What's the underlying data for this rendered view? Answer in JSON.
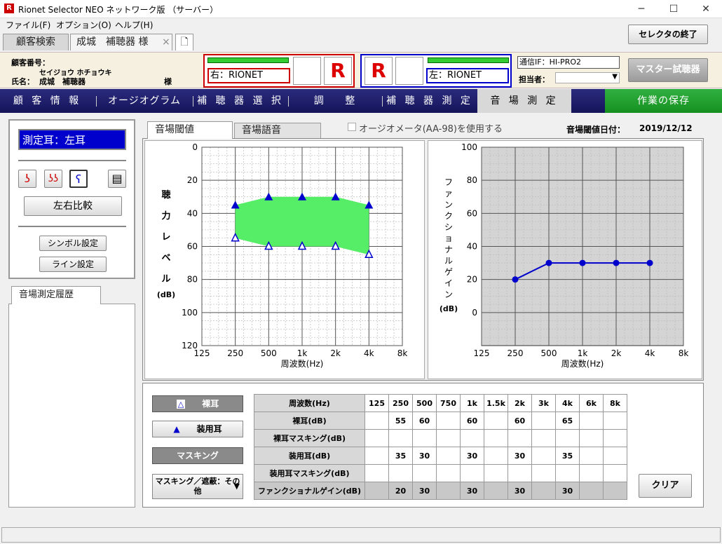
{
  "window": {
    "title": "Rionet Selector NEO ネットワーク版 （サーバー）",
    "icon": "R"
  },
  "menu": [
    "ファイル(F)",
    "オプション(O)",
    "ヘルプ(H)"
  ],
  "tabs": {
    "search": "顧客検索",
    "customer": "成城　補聴器 様",
    "close": "×"
  },
  "exit_button": "セレクタの終了",
  "info": {
    "customer_no_label": "顧客番号：",
    "kana": "セイジョウ ホチョウキ",
    "name_label": "氏名：",
    "name": "成城　補聴器",
    "sama": "様",
    "right_label": "右：RIONET",
    "left_label": "左：RIONET",
    "comm_label": "通信IF：HI-PRO2",
    "staff_label": "担当者：",
    "staff_value": "",
    "master_button": "マスター試聴器"
  },
  "nav": [
    "顧 客 情 報",
    "オージオグラム",
    "補 聴 器 選 択",
    "調　 整",
    "補 聴 器 測 定",
    "音 場 測 定",
    "作業の保存"
  ],
  "left": {
    "ear": "測定耳：左耳",
    "compare": "左右比較",
    "symbol": "シンボル設定",
    "line": "ライン設定",
    "history_tab": "音場測定履歴"
  },
  "subtabs": {
    "threshold": "音場閾値",
    "speech": "音場語音"
  },
  "audiometer_check": "オージオメータ(AA-98)を使用する",
  "date": {
    "label": "音場閾値日付：",
    "value": "2019/12/12"
  },
  "chart_data": [
    {
      "type": "line",
      "x": [
        "125",
        "250",
        "500",
        "1k",
        "2k",
        "4k",
        "8k"
      ],
      "ylabel": "聴力レベル (dB)",
      "xlabel": "周波数(Hz)",
      "yticks": [
        "0",
        "20",
        "40",
        "60",
        "80",
        "100",
        "120"
      ],
      "ylim": [
        0,
        120
      ],
      "series": [
        {
          "name": "装用耳",
          "x": [
            "250",
            "500",
            "1k",
            "2k",
            "4k"
          ],
          "values": [
            35,
            30,
            30,
            30,
            35
          ]
        },
        {
          "name": "裸耳",
          "x": [
            "250",
            "500",
            "1k",
            "2k",
            "4k"
          ],
          "values": [
            55,
            60,
            60,
            60,
            65
          ]
        }
      ]
    },
    {
      "type": "line",
      "x": [
        "125",
        "250",
        "500",
        "1k",
        "2k",
        "4k",
        "8k"
      ],
      "ylabel": "ファンクショナルゲイン (dB)",
      "xlabel": "周波数(Hz)",
      "yticks": [
        "100",
        "80",
        "60",
        "40",
        "20",
        "0"
      ],
      "ylim": [
        -20,
        100
      ],
      "series": [
        {
          "name": "ファンクショナルゲイン",
          "x": [
            "250",
            "500",
            "1k",
            "2k",
            "4k"
          ],
          "values": [
            20,
            30,
            30,
            30,
            30
          ]
        }
      ]
    }
  ],
  "legend": {
    "bare": "裸耳",
    "aided": "装用耳",
    "masking": "マスキング",
    "other": "マスキング／遮蔽：その他"
  },
  "table": {
    "header": "周波数(Hz)",
    "freqs": [
      "125",
      "250",
      "500",
      "750",
      "1k",
      "1.5k",
      "2k",
      "3k",
      "4k",
      "6k",
      "8k"
    ],
    "rows": [
      {
        "label": "裸耳(dB)",
        "vals": [
          "",
          "55",
          "60",
          "",
          "60",
          "",
          "60",
          "",
          "65",
          "",
          ""
        ]
      },
      {
        "label": "裸耳マスキング(dB)",
        "vals": [
          "",
          "",
          "",
          "",
          "",
          "",
          "",
          "",
          "",
          "",
          ""
        ]
      },
      {
        "label": "装用耳(dB)",
        "vals": [
          "",
          "35",
          "30",
          "",
          "30",
          "",
          "30",
          "",
          "35",
          "",
          ""
        ]
      },
      {
        "label": "装用耳マスキング(dB)",
        "vals": [
          "",
          "",
          "",
          "",
          "",
          "",
          "",
          "",
          "",
          "",
          ""
        ]
      },
      {
        "label": "ファンクショナルゲイン(dB)",
        "vals": [
          "",
          "20",
          "30",
          "",
          "30",
          "",
          "30",
          "",
          "30",
          "",
          ""
        ]
      }
    ]
  },
  "clear_button": "クリア",
  "colors": {
    "nav": "#1c1c6a",
    "save": "#1a9a2a",
    "plot": "#0000cc",
    "fill": "#55ee66"
  }
}
